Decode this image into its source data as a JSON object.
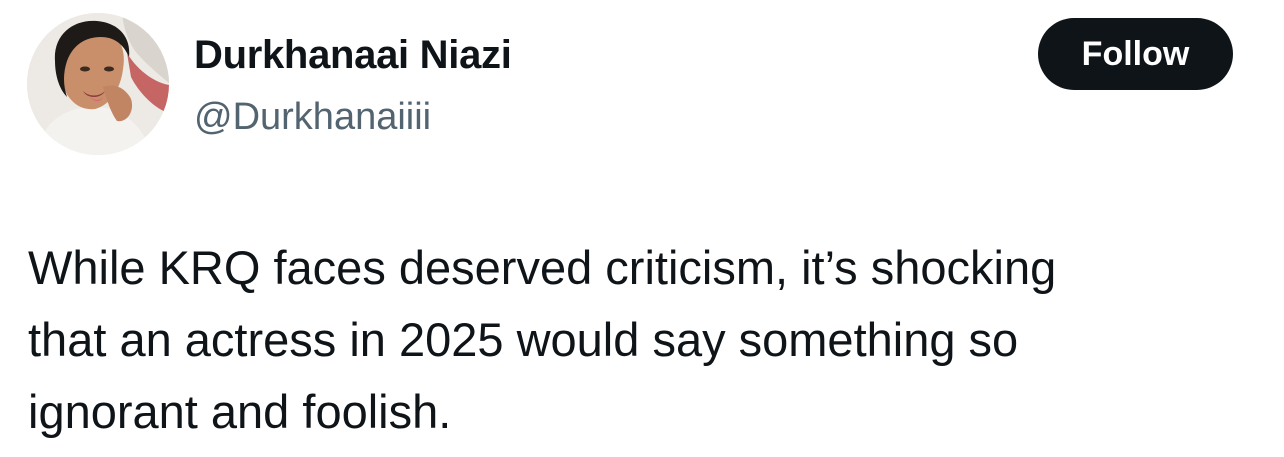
{
  "user": {
    "display_name": "Durkhanaai Niazi",
    "handle": "@Durkhanaiiii",
    "avatar_icon": "profile-photo"
  },
  "actions": {
    "follow_label": "Follow"
  },
  "tweet": {
    "lines": [
      "While KRQ faces deserved criticism, it’s shocking",
      "that an actress in 2025 would say something so",
      "ignorant and foolish."
    ]
  },
  "colors": {
    "text_primary": "#0f1419",
    "text_secondary": "#536471",
    "button_bg": "#0f1419",
    "button_text": "#ffffff",
    "background": "#ffffff"
  }
}
